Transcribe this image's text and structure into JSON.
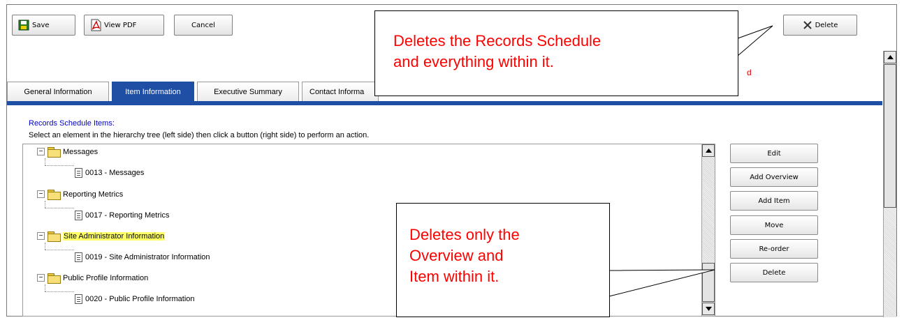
{
  "toolbar": {
    "save_label": "Save",
    "view_pdf_label": "View PDF",
    "cancel_label": "Cancel",
    "delete_label": "Delete"
  },
  "page_notice": "d",
  "tabs": [
    {
      "label": "General Information"
    },
    {
      "label": "Item Information"
    },
    {
      "label": "Executive Summary"
    },
    {
      "label": "Contact Informa"
    }
  ],
  "content": {
    "section_title": "Records Schedule Items:",
    "instructions": "Select an element in the hierarchy tree (left side) then click a button (right side) to perform an action."
  },
  "tree": [
    {
      "type": "folder",
      "label": "Messages"
    },
    {
      "type": "item",
      "label": "0013 - Messages"
    },
    {
      "type": "folder",
      "label": "Reporting Metrics"
    },
    {
      "type": "item",
      "label": "0017 - Reporting Metrics"
    },
    {
      "type": "folder",
      "label": "Site Administrator Information",
      "highlighted": true
    },
    {
      "type": "item",
      "label": "0019 - Site Administrator Information"
    },
    {
      "type": "folder",
      "label": "Public Profile Information"
    },
    {
      "type": "item",
      "label": "0020 - Public Profile Information"
    }
  ],
  "actions": {
    "edit": "Edit",
    "add_overview": "Add Overview",
    "add_item": "Add Item",
    "move": "Move",
    "reorder": "Re-order",
    "delete": "Delete"
  },
  "callouts": {
    "top_line1": "Deletes the Records Schedule",
    "top_line2": "and everything within it.",
    "bottom_line1": "Deletes only the",
    "bottom_line2": "Overview and",
    "bottom_line3": "Item within it."
  },
  "colors": {
    "tab_active": "#1f4ea5",
    "callout_text": "#ff0000",
    "highlight": "#ffff66",
    "section_title": "#0000cc"
  }
}
